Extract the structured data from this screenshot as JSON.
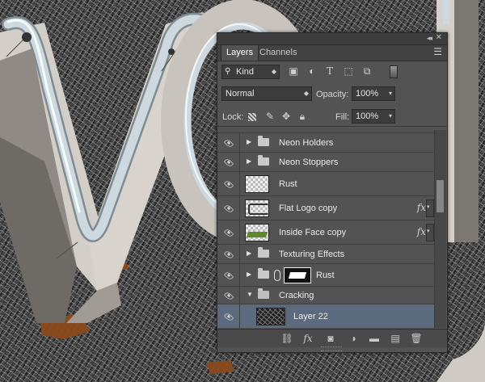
{
  "panel": {
    "tabs": [
      {
        "label": "Layers",
        "active": true
      },
      {
        "label": "Channels",
        "active": false
      }
    ],
    "filter": {
      "kind_label": "Kind",
      "filter_icons": [
        "image-filter-icon",
        "adjustment-filter-icon",
        "type-filter-icon",
        "shape-filter-icon",
        "smart-object-filter-icon"
      ]
    },
    "blend_mode": "Normal",
    "opacity_label": "Opacity:",
    "opacity_value": "100%",
    "lock_label": "Lock:",
    "fill_label": "Fill:",
    "fill_value": "100%"
  },
  "layers": [
    {
      "name": "Neon Holders",
      "type": "group",
      "expanded": false
    },
    {
      "name": "Neon Stoppers",
      "type": "group",
      "expanded": false
    },
    {
      "name": "Rust",
      "type": "layer",
      "thumb": "transparent"
    },
    {
      "name": "Flat Logo copy",
      "type": "layer",
      "thumb": "logo",
      "fx": true
    },
    {
      "name": "Inside Face copy",
      "type": "layer",
      "thumb": "face",
      "fx": true
    },
    {
      "name": "Texturing Effects",
      "type": "group",
      "expanded": false
    },
    {
      "name": "Rust",
      "type": "group-masked",
      "expanded": false
    },
    {
      "name": "Cracking",
      "type": "group",
      "expanded": true
    },
    {
      "name": "Layer 22",
      "type": "layer",
      "thumb": "crack",
      "selected": true
    }
  ],
  "fx_label": "fx",
  "colors": {
    "panel_bg": "#535353",
    "selected_row": "#5b6a7d",
    "tube_color": "#c9d5da",
    "letter_face": "#cfcac4",
    "rust": "#8a4a1c",
    "ground": "#3c3c3c"
  }
}
